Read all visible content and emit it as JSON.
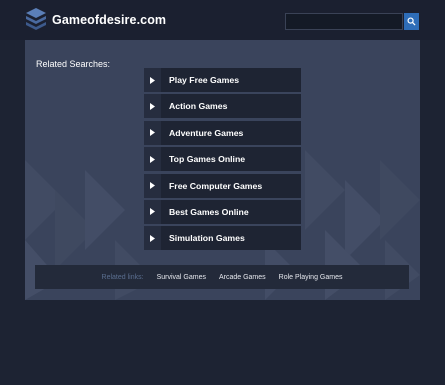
{
  "header": {
    "logo_text": "Gameofdesire.com",
    "search": {
      "placeholder": "",
      "value": ""
    }
  },
  "colors": {
    "background": "#1d2333",
    "panel": "#3a445c",
    "link_item": "#1e2433",
    "accent": "#2e6db8",
    "footer_label": "#5a6e8f"
  },
  "related": {
    "title": "Related Searches:",
    "items": [
      {
        "label": "Play Free Games"
      },
      {
        "label": "Action Games"
      },
      {
        "label": "Adventure Games"
      },
      {
        "label": "Top Games Online"
      },
      {
        "label": "Free Computer Games"
      },
      {
        "label": "Best Games Online"
      },
      {
        "label": "Simulation Games"
      }
    ]
  },
  "footer": {
    "label": "Related links:",
    "links": [
      {
        "label": "Survival Games"
      },
      {
        "label": "Arcade Games"
      },
      {
        "label": "Role Playing Games"
      }
    ]
  }
}
